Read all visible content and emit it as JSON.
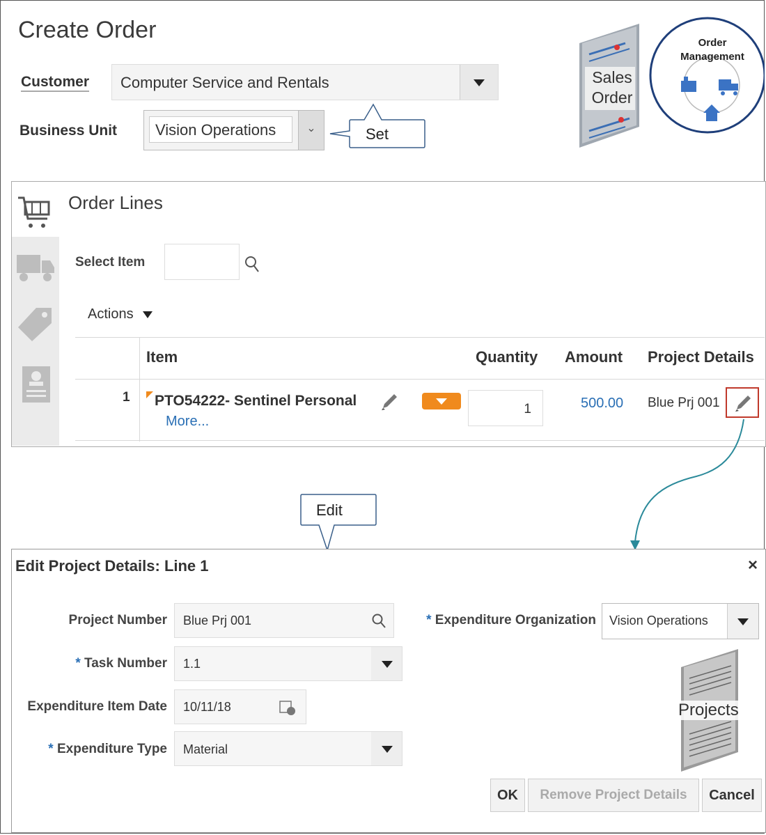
{
  "header": {
    "title": "Create Order"
  },
  "customer": {
    "label": "Customer",
    "value": "Computer Service and Rentals"
  },
  "business_unit": {
    "label": "Business Unit",
    "value": "Vision Operations"
  },
  "callouts": {
    "set": "Set",
    "edit": "Edit"
  },
  "badges": {
    "sales_order_line1": "Sales",
    "sales_order_line2": "Order",
    "om_line1": "Order",
    "om_line2": "Management",
    "projects": "Projects"
  },
  "order_lines": {
    "title": "Order Lines",
    "select_item_label": "Select Item",
    "actions_label": "Actions",
    "columns": {
      "item": "Item",
      "quantity": "Quantity",
      "amount": "Amount",
      "project_details": "Project Details"
    },
    "rows": [
      {
        "num": "1",
        "item": "PTO54222- Sentinel Personal",
        "more": "More...",
        "quantity": "1",
        "amount": "500.00",
        "project_details": "Blue Prj 001"
      }
    ]
  },
  "dialog": {
    "title": "Edit Project Details: Line 1",
    "close": "×",
    "project_number": {
      "label": "Project Number",
      "value": "Blue Prj 001"
    },
    "task_number": {
      "label": "Task Number",
      "value": "1.1"
    },
    "expenditure_item_date": {
      "label": "Expenditure Item Date",
      "value": "10/11/18"
    },
    "expenditure_type": {
      "label": "Expenditure Type",
      "value": "Material"
    },
    "expenditure_org": {
      "label": "Expenditure Organization",
      "value": "Vision Operations"
    },
    "required_mark": "*",
    "buttons": {
      "ok": "OK",
      "remove": "Remove Project Details",
      "cancel": "Cancel"
    }
  },
  "colors": {
    "accent_orange": "#f08a1d",
    "link_blue": "#2a6fb5",
    "teal_arrow": "#2b8a9a",
    "om_circle": "#1f3f7a",
    "highlight_red": "#c0392b"
  }
}
